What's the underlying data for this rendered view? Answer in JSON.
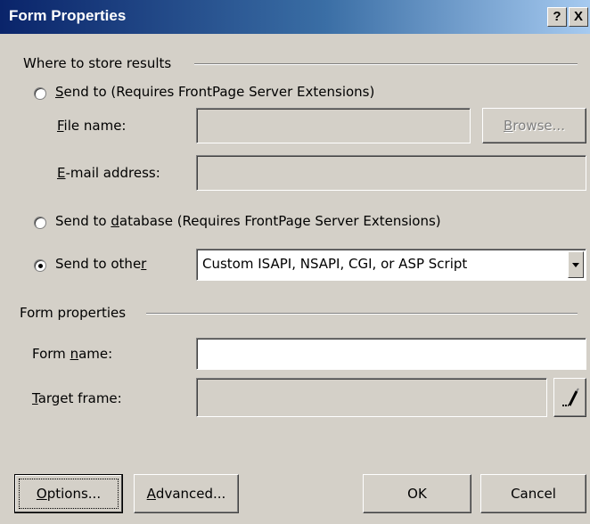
{
  "window": {
    "title": "Form Properties",
    "help_label": "?",
    "close_label": "X"
  },
  "store_group": {
    "title": "Where to store results",
    "send_to": {
      "label_u": "S",
      "label_rest": "end to (Requires FrontPage Server Extensions)",
      "checked": false
    },
    "file_name": {
      "label_u": "F",
      "label_rest": "ile name:",
      "value": ""
    },
    "browse_button": {
      "label_u": "B",
      "label_rest": "rowse...",
      "enabled": false
    },
    "email": {
      "label_u": "E",
      "label_rest": "-mail address:",
      "value": ""
    },
    "send_db": {
      "label_pre": "Send to ",
      "label_u": "d",
      "label_rest": "atabase (Requires FrontPage Server Extensions)",
      "checked": false
    },
    "send_other": {
      "label_pre": "Send to othe",
      "label_u": "r",
      "checked": true,
      "selected_option": "Custom ISAPI, NSAPI, CGI, or ASP Script"
    }
  },
  "form_group": {
    "title": "Form properties",
    "form_name": {
      "label_pre": "Form ",
      "label_u": "n",
      "label_rest": "ame:",
      "value": ""
    },
    "target_frame": {
      "label_u": "T",
      "label_rest": "arget frame:",
      "value": ""
    },
    "target_button_icon": "pencil-icon"
  },
  "footer": {
    "options": {
      "label_u": "O",
      "label_rest": "ptions..."
    },
    "advanced": {
      "label_u": "A",
      "label_rest": "dvanced..."
    },
    "ok": "OK",
    "cancel": "Cancel"
  }
}
